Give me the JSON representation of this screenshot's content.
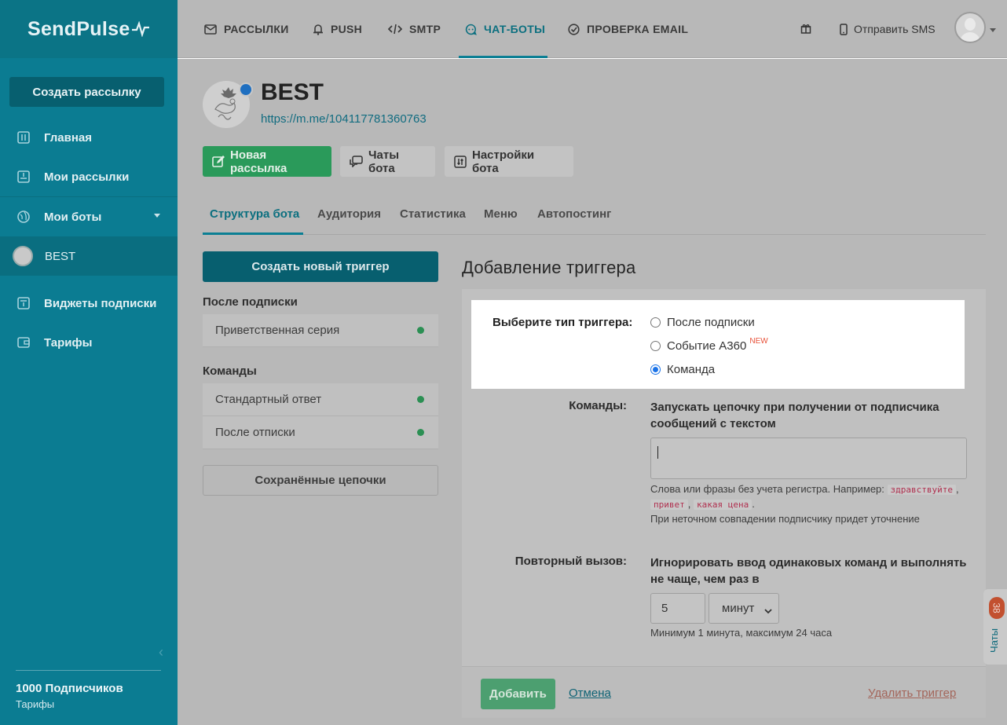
{
  "sidebar": {
    "logo": "SendPulse",
    "create_button": "Создать рассылку",
    "items": [
      {
        "label": "Главная",
        "icon": "home-icon"
      },
      {
        "label": "Мои рассылки",
        "icon": "mailings-icon"
      },
      {
        "label": "Мои боты",
        "icon": "globe-icon"
      },
      {
        "label": "BEST",
        "icon": "bot-avatar"
      },
      {
        "label": "Виджеты подписки",
        "icon": "widget-icon"
      },
      {
        "label": "Тарифы",
        "icon": "wallet-icon"
      }
    ],
    "subscribers": "1000 Подписчиков",
    "tariffs_link": "Тарифы"
  },
  "topnav": {
    "items": [
      {
        "label": "РАССЫЛКИ",
        "icon": "envelope-icon"
      },
      {
        "label": "PUSH",
        "icon": "bell-icon"
      },
      {
        "label": "SMTP",
        "icon": "code-icon"
      },
      {
        "label": "ЧАТ-БОТЫ",
        "icon": "chatbot-icon",
        "active": true
      },
      {
        "label": "ПРОВЕРКА EMAIL",
        "icon": "check-circle-icon"
      }
    ],
    "gift_icon": "gift-icon",
    "send_sms": "Отправить SMS"
  },
  "bot": {
    "name": "BEST",
    "link": "https://m.me/104117781360763"
  },
  "actions": {
    "new_mailing": "Новая рассылка",
    "bot_chats": "Чаты бота",
    "bot_settings": "Настройки бота"
  },
  "tabs": [
    "Структура бота",
    "Аудитория",
    "Статистика",
    "Меню",
    "Автопостинг"
  ],
  "triggers": {
    "create_button": "Создать новый триггер",
    "after_subscribe_title": "После подписки",
    "after_subscribe_items": [
      "Приветственная серия"
    ],
    "commands_title": "Команды",
    "commands_items": [
      "Стандартный ответ",
      "После отписки"
    ],
    "saved_chains_button": "Сохранённые цепочки"
  },
  "form": {
    "title": "Добавление триггера",
    "trigger_type_label": "Выберите тип триггера:",
    "trigger_options": [
      {
        "label": "После подписки",
        "checked": false
      },
      {
        "label": "Событие A360",
        "badge": "NEW",
        "checked": false
      },
      {
        "label": "Команда",
        "checked": true
      }
    ],
    "commands_label": "Команды:",
    "commands_desc_line1": "Запускать цепочку при получении от подписчика",
    "commands_desc_line2": "сообщений с текстом",
    "commands_input_value": "",
    "help_line1": "Слова или фразы без учета регистра. Например:",
    "help_examples": [
      "здравствуйте",
      "привет",
      "какая цена"
    ],
    "help_line3": "При неточном совпадении подписчику придет уточнение",
    "repeat_label": "Повторный вызов:",
    "repeat_desc_line1": "Игнорировать ввод одинаковых команд и выполнять",
    "repeat_desc_line2": "не чаще, чем раз в",
    "repeat_value": "5",
    "repeat_unit": "минут",
    "repeat_help": "Минимум 1 минута, максимум 24 часа",
    "add_button": "Добавить",
    "cancel_link": "Отмена",
    "delete_link": "Удалить триггер"
  },
  "chats_widget": {
    "count": "38",
    "label": "Чаты"
  }
}
